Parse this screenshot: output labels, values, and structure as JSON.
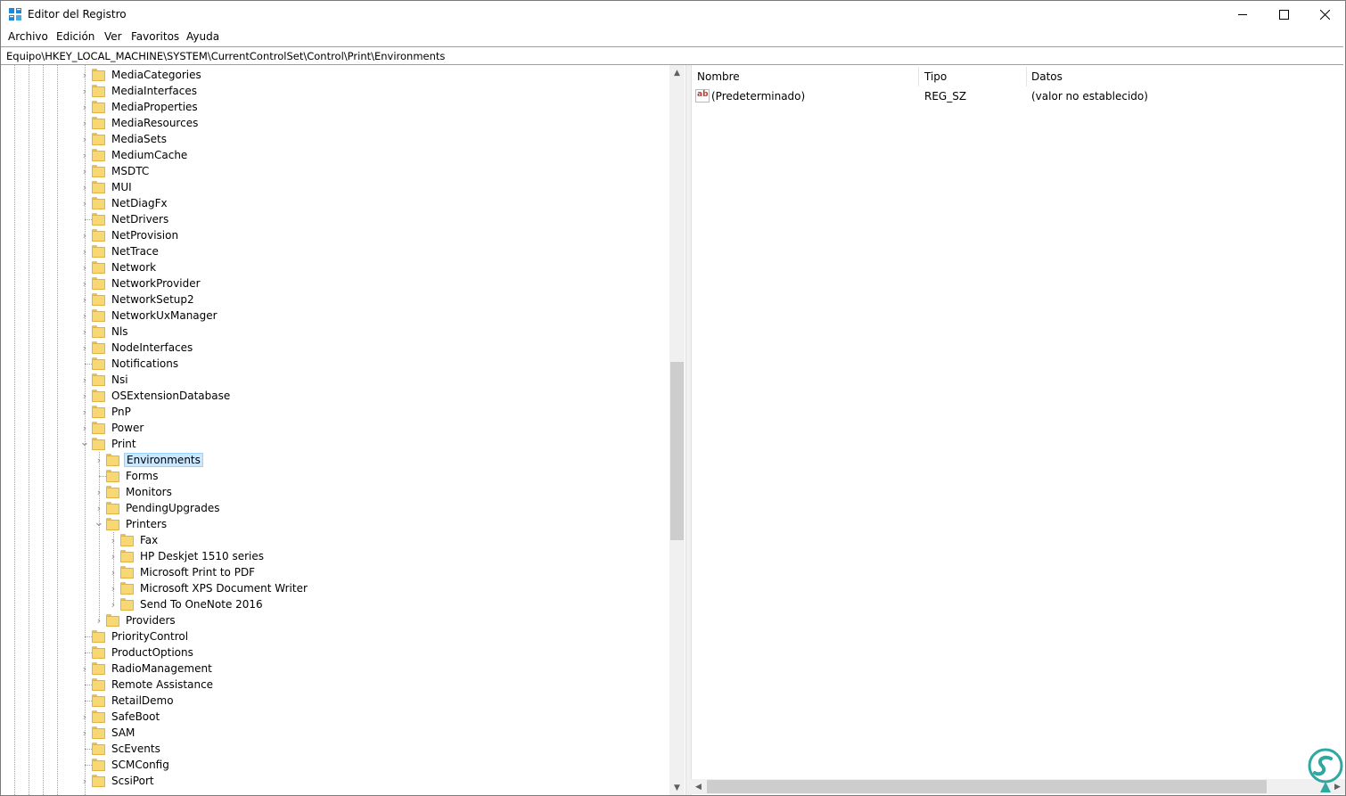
{
  "window": {
    "title": "Editor del Registro",
    "minimize": "–",
    "maximize": "☐",
    "close": "✕"
  },
  "menu": [
    "Archivo",
    "Edición",
    "Ver",
    "Favoritos",
    "Ayuda"
  ],
  "address": "Equipo\\HKEY_LOCAL_MACHINE\\SYSTEM\\CurrentControlSet\\Control\\Print\\Environments",
  "tree": [
    {
      "label": "MediaCategories",
      "depth": 0,
      "state": "collapsed"
    },
    {
      "label": "MediaInterfaces",
      "depth": 0,
      "state": "collapsed"
    },
    {
      "label": "MediaProperties",
      "depth": 0,
      "state": "collapsed"
    },
    {
      "label": "MediaResources",
      "depth": 0,
      "state": "collapsed"
    },
    {
      "label": "MediaSets",
      "depth": 0,
      "state": "collapsed"
    },
    {
      "label": "MediumCache",
      "depth": 0,
      "state": "collapsed"
    },
    {
      "label": "MSDTC",
      "depth": 0,
      "state": "collapsed"
    },
    {
      "label": "MUI",
      "depth": 0,
      "state": "collapsed"
    },
    {
      "label": "NetDiagFx",
      "depth": 0,
      "state": "collapsed"
    },
    {
      "label": "NetDrivers",
      "depth": 0,
      "state": "leaf"
    },
    {
      "label": "NetProvision",
      "depth": 0,
      "state": "collapsed"
    },
    {
      "label": "NetTrace",
      "depth": 0,
      "state": "collapsed"
    },
    {
      "label": "Network",
      "depth": 0,
      "state": "collapsed"
    },
    {
      "label": "NetworkProvider",
      "depth": 0,
      "state": "collapsed"
    },
    {
      "label": "NetworkSetup2",
      "depth": 0,
      "state": "collapsed"
    },
    {
      "label": "NetworkUxManager",
      "depth": 0,
      "state": "collapsed"
    },
    {
      "label": "Nls",
      "depth": 0,
      "state": "collapsed"
    },
    {
      "label": "NodeInterfaces",
      "depth": 0,
      "state": "collapsed"
    },
    {
      "label": "Notifications",
      "depth": 0,
      "state": "leaf"
    },
    {
      "label": "Nsi",
      "depth": 0,
      "state": "collapsed"
    },
    {
      "label": "OSExtensionDatabase",
      "depth": 0,
      "state": "collapsed"
    },
    {
      "label": "PnP",
      "depth": 0,
      "state": "collapsed"
    },
    {
      "label": "Power",
      "depth": 0,
      "state": "collapsed"
    },
    {
      "label": "Print",
      "depth": 0,
      "state": "expanded"
    },
    {
      "label": "Environments",
      "depth": 1,
      "state": "collapsed",
      "selected": true
    },
    {
      "label": "Forms",
      "depth": 1,
      "state": "leaf"
    },
    {
      "label": "Monitors",
      "depth": 1,
      "state": "collapsed"
    },
    {
      "label": "PendingUpgrades",
      "depth": 1,
      "state": "collapsed"
    },
    {
      "label": "Printers",
      "depth": 1,
      "state": "expanded"
    },
    {
      "label": "Fax",
      "depth": 2,
      "state": "collapsed"
    },
    {
      "label": "HP Deskjet 1510 series",
      "depth": 2,
      "state": "collapsed"
    },
    {
      "label": "Microsoft Print to PDF",
      "depth": 2,
      "state": "collapsed"
    },
    {
      "label": "Microsoft XPS Document Writer",
      "depth": 2,
      "state": "collapsed"
    },
    {
      "label": "Send To OneNote 2016",
      "depth": 2,
      "state": "collapsed"
    },
    {
      "label": "Providers",
      "depth": 1,
      "state": "collapsed"
    },
    {
      "label": "PriorityControl",
      "depth": 0,
      "state": "leaf"
    },
    {
      "label": "ProductOptions",
      "depth": 0,
      "state": "leaf"
    },
    {
      "label": "RadioManagement",
      "depth": 0,
      "state": "collapsed"
    },
    {
      "label": "Remote Assistance",
      "depth": 0,
      "state": "leaf"
    },
    {
      "label": "RetailDemo",
      "depth": 0,
      "state": "leaf"
    },
    {
      "label": "SafeBoot",
      "depth": 0,
      "state": "collapsed"
    },
    {
      "label": "SAM",
      "depth": 0,
      "state": "collapsed"
    },
    {
      "label": "ScEvents",
      "depth": 0,
      "state": "leaf"
    },
    {
      "label": "SCMConfig",
      "depth": 0,
      "state": "leaf"
    },
    {
      "label": "ScsiPort",
      "depth": 0,
      "state": "collapsed"
    }
  ],
  "list": {
    "columns": [
      "Nombre",
      "Tipo",
      "Datos"
    ],
    "rows": [
      {
        "name": "(Predeterminado)",
        "type": "REG_SZ",
        "data": "(valor no establecido)",
        "icon": "ab-string-icon",
        "icon_text": "ab"
      }
    ]
  },
  "colors": {
    "folder": "#f8d775",
    "selection": "#cce8ff",
    "watermark": "#2ea8a1"
  }
}
